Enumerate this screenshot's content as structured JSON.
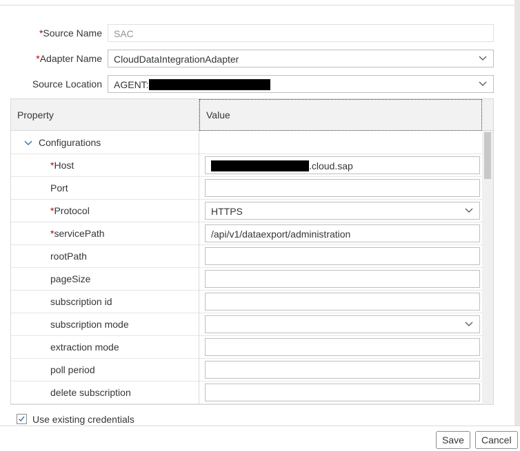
{
  "form": {
    "source_name": {
      "required": "*",
      "label": "Source Name",
      "value": "SAC"
    },
    "adapter_name": {
      "required": "*",
      "label": "Adapter Name",
      "value": "CloudDataIntegrationAdapter"
    },
    "source_location": {
      "label": "Source Location",
      "value": "AGENT:"
    }
  },
  "grid": {
    "headers": {
      "property": "Property",
      "value": "Value"
    },
    "group": {
      "label": "Configurations"
    },
    "rows": [
      {
        "required": "*",
        "label": "Host",
        "value": ".cloud.sap",
        "type": "input-redacted"
      },
      {
        "required": "",
        "label": "Port",
        "value": "",
        "type": "input"
      },
      {
        "required": "*",
        "label": "Protocol",
        "value": "HTTPS",
        "type": "select"
      },
      {
        "required": "*",
        "label": "servicePath",
        "value": "/api/v1/dataexport/administration",
        "type": "input"
      },
      {
        "required": "",
        "label": "rootPath",
        "value": "",
        "type": "input"
      },
      {
        "required": "",
        "label": "pageSize",
        "value": "",
        "type": "input"
      },
      {
        "required": "",
        "label": "subscription id",
        "value": "",
        "type": "input"
      },
      {
        "required": "",
        "label": "subscription mode",
        "value": "",
        "type": "select"
      },
      {
        "required": "",
        "label": "extraction mode",
        "value": "",
        "type": "input"
      },
      {
        "required": "",
        "label": "poll period",
        "value": "",
        "type": "input"
      },
      {
        "required": "",
        "label": "delete subscription",
        "value": "",
        "type": "input"
      }
    ]
  },
  "credentials": {
    "label": "Use existing credentials",
    "checked": true
  },
  "buttons": {
    "save": "Save",
    "cancel": "Cancel"
  },
  "colors": {
    "required": "#bb0000",
    "border": "#bfbfbf",
    "header_bg": "#f2f2f2"
  }
}
